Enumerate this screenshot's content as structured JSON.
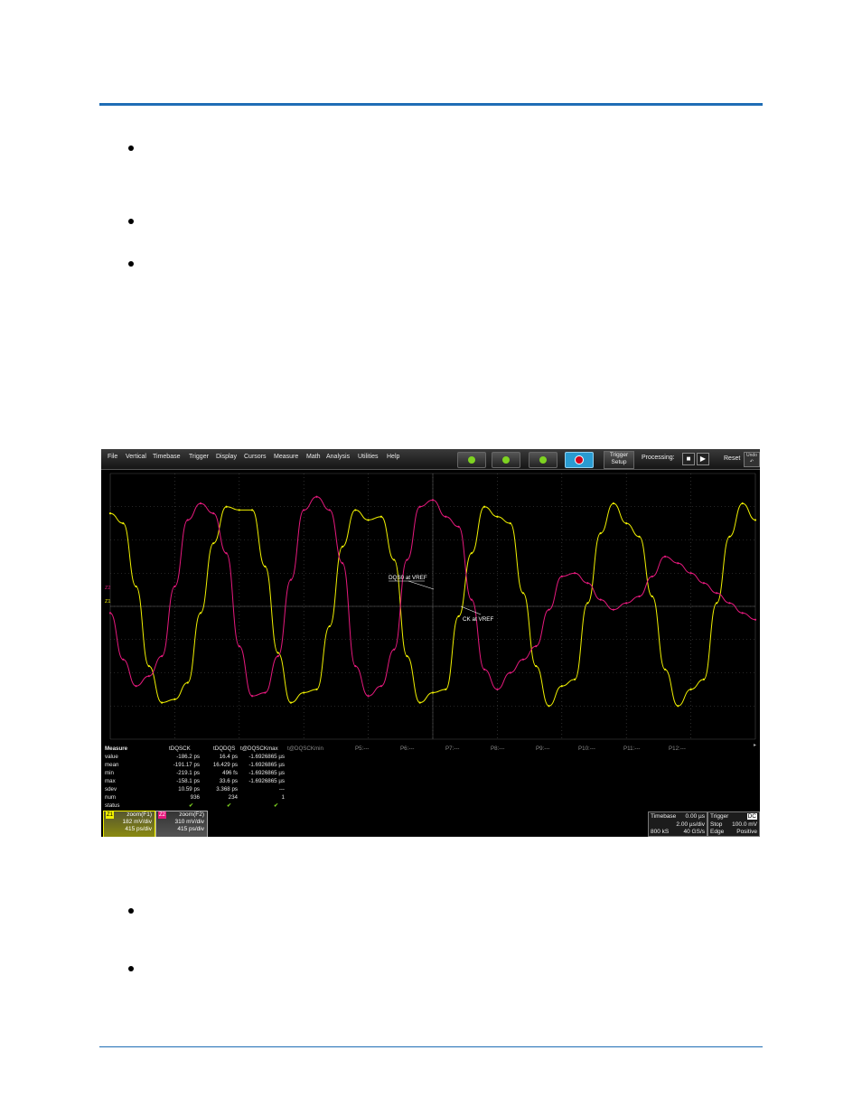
{
  "scope": {
    "menu": [
      "File",
      "Vertical",
      "Timebase",
      "Trigger",
      "Display",
      "Cursors",
      "Measure",
      "Math",
      "Analysis",
      "Utilities",
      "Help"
    ],
    "trigger_setup": [
      "Trigger",
      "Setup"
    ],
    "processing_label": "Processing:",
    "reset_label": "Reset",
    "undo_label": "Undo",
    "toolbar_icons": [
      "auto-setup-icon",
      "clear-sweeps-icon",
      "single-capture-icon",
      "stop-acquisition-icon"
    ],
    "annotations": {
      "dqs": "DQS0 at VREF",
      "ck": "CK at VREF"
    },
    "channel_labels": {
      "z2": "Z2",
      "z1": "Z1"
    },
    "colors": {
      "yellow": "#f0f000",
      "magenta": "#e6197d",
      "grid": "#4a4a4a"
    },
    "measure": {
      "row_labels": [
        "Measure",
        "value",
        "mean",
        "min",
        "max",
        "sdev",
        "num",
        "status"
      ],
      "headers": [
        "tDQSCK",
        "tDQDQS",
        "t@DQSCKmax",
        "t@DQSCKmin",
        "P5:---",
        "P6:---",
        "P7:---",
        "P8:---",
        "P9:---",
        "P10:---",
        "P11:---",
        "P12:---"
      ],
      "col1": [
        "-186.2 ps",
        "-191.17 ps",
        "-219.1 ps",
        "-158.1 ps",
        "10.59 ps",
        "936"
      ],
      "col2": [
        "16.4 ps",
        "16.429 ps",
        "496 fs",
        "33.6 ps",
        "3.368 ps",
        "234"
      ],
      "col3": [
        "-1.6926865 µs",
        "-1.6926865 µs",
        "-1.6926865 µs",
        "-1.6926865 µs",
        "---",
        "1"
      ],
      "status": [
        "✔",
        "✔",
        "✔"
      ]
    },
    "channels": [
      {
        "tag": "Z1",
        "name": "zoom(F1)",
        "vdiv": "182 mV/div",
        "tdiv": "415 ps/div"
      },
      {
        "tag": "Z2",
        "name": "zoom(F2)",
        "vdiv": "310 mV/div",
        "tdiv": "415 ps/div"
      }
    ],
    "timebase": {
      "label": "Timebase",
      "delay": "0.00 µs",
      "tdiv": "2.00 µs/div",
      "samples": "800 kS",
      "rate": "40 GS/s"
    },
    "trigger": {
      "label": "Trigger",
      "coupling": "DC",
      "mode": "Stop",
      "level": "100.0 mV",
      "type": "Edge",
      "slope": "Positive"
    }
  },
  "chart_data": {
    "type": "line",
    "x_unit": "div",
    "xlim": [
      0,
      10
    ],
    "ylim": [
      -4,
      4
    ],
    "grid": true,
    "series": [
      {
        "color": "#f0f000",
        "x": [
          0,
          0.2,
          0.4,
          0.6,
          0.8,
          1.0,
          1.2,
          1.4,
          1.6,
          1.8,
          2.0,
          2.2,
          2.4,
          2.6,
          2.8,
          3.0,
          3.2,
          3.4,
          3.6,
          3.8,
          4.0,
          4.2,
          4.4,
          4.6,
          4.8,
          5.0,
          5.2,
          5.4,
          5.6,
          5.8,
          6.0,
          6.2,
          6.4,
          6.6,
          6.8,
          7.0,
          7.2,
          7.4,
          7.6,
          7.8,
          8.0,
          8.2,
          8.4,
          8.6,
          8.8,
          9.0,
          9.2,
          9.4,
          9.6,
          9.8,
          10.0
        ],
        "values": [
          2.8,
          2.5,
          0.6,
          -1.8,
          -2.9,
          -2.8,
          -2.3,
          -0.2,
          1.9,
          3.0,
          2.9,
          2.9,
          1.2,
          -1.4,
          -2.9,
          -2.6,
          -2.5,
          -0.6,
          1.8,
          2.9,
          2.6,
          2.7,
          1.4,
          -1.5,
          -2.9,
          -2.6,
          -2.5,
          -0.3,
          1.6,
          3.0,
          2.7,
          2.5,
          0.4,
          -1.8,
          -3.0,
          -2.4,
          -2.2,
          0.1,
          2.2,
          3.1,
          2.5,
          2.1,
          0.3,
          -1.9,
          -3.0,
          -2.5,
          -2.2,
          0.1,
          2.1,
          3.1,
          2.6
        ]
      },
      {
        "color": "#e6197d",
        "x": [
          0,
          0.2,
          0.4,
          0.6,
          0.8,
          1.0,
          1.2,
          1.4,
          1.6,
          1.8,
          2.0,
          2.2,
          2.4,
          2.6,
          2.8,
          3.0,
          3.2,
          3.4,
          3.6,
          3.8,
          4.0,
          4.2,
          4.4,
          4.6,
          4.8,
          5.0,
          5.2,
          5.4,
          5.6,
          5.8,
          6.0,
          6.2,
          6.4,
          6.6,
          6.8,
          7.0,
          7.2,
          7.4,
          7.6,
          7.8,
          8.0,
          8.2,
          8.4,
          8.6,
          8.8,
          9.0,
          9.2,
          9.4,
          9.6,
          9.8,
          10.0
        ],
        "values": [
          -0.2,
          -1.6,
          -2.4,
          -2.1,
          -1.5,
          0.6,
          2.6,
          3.1,
          2.8,
          1.6,
          -1.2,
          -2.7,
          -2.6,
          -1.5,
          0.8,
          2.9,
          3.3,
          2.9,
          1.3,
          -1.8,
          -2.7,
          -2.4,
          -1.3,
          1.4,
          3.0,
          3.2,
          2.7,
          2.4,
          0.2,
          -1.9,
          -2.5,
          -2.0,
          -1.6,
          -1.2,
          -0.1,
          0.9,
          1.0,
          0.7,
          0.2,
          -0.1,
          0.1,
          0.3,
          0.9,
          1.5,
          1.3,
          1.0,
          0.7,
          0.4,
          0.1,
          -0.2,
          -0.4
        ]
      }
    ]
  }
}
